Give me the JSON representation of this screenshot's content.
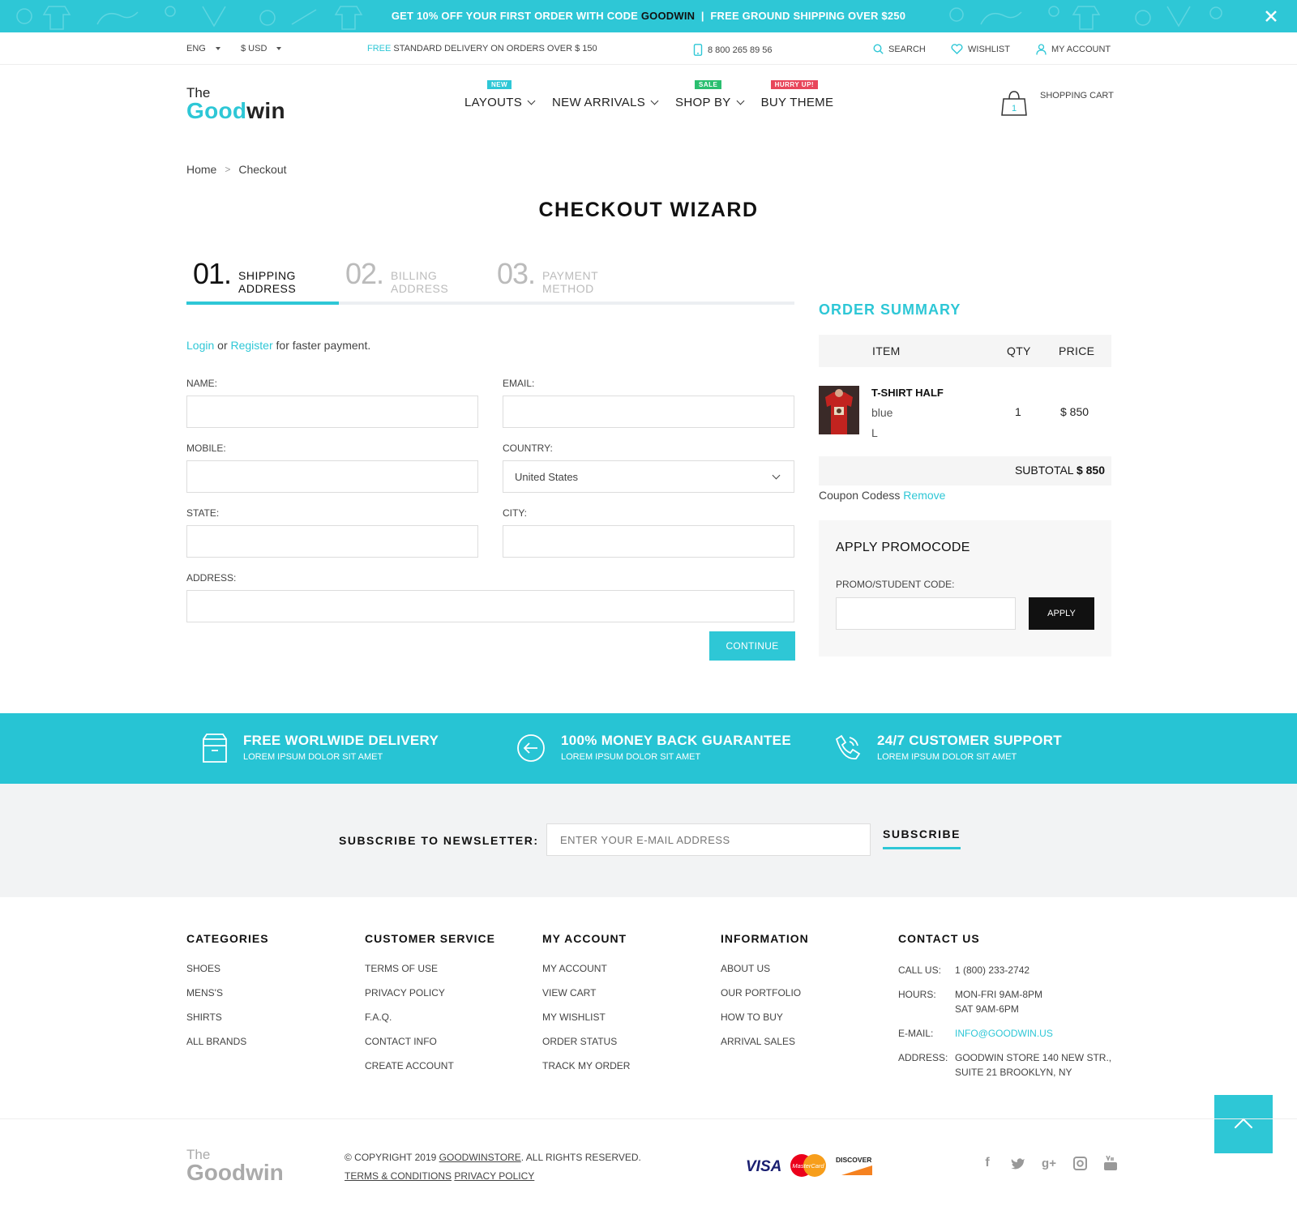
{
  "promo": {
    "prefix": "GET 10% OFF YOUR FIRST ORDER WITH CODE",
    "code": "GOODWIN",
    "separator": "|",
    "suffix": "FREE GROUND SHIPPING OVER $250"
  },
  "topbar": {
    "language": "ENG",
    "currency": "$ USD",
    "delivery_free": "FREE",
    "delivery_text": "STANDARD DELIVERY ON ORDERS OVER $ 150",
    "phone": "8 800 265 89 56",
    "search": "SEARCH",
    "wishlist": "WISHLIST",
    "account": "MY ACCOUNT"
  },
  "logo": {
    "the": "The",
    "good": "Good",
    "win": "win"
  },
  "nav": [
    {
      "label": "LAYOUTS",
      "badge": "NEW"
    },
    {
      "label": "NEW ARRIVALS",
      "badge": ""
    },
    {
      "label": "SHOP BY",
      "badge": "SALE"
    },
    {
      "label": "BUY THEME",
      "badge": "HURRY UP!"
    }
  ],
  "cart": {
    "label": "SHOPPING CART",
    "count": "1"
  },
  "breadcrumb": {
    "home": "Home",
    "sep": ">",
    "current": "Checkout"
  },
  "title": "CHECKOUT WIZARD",
  "steps": [
    {
      "num": "01.",
      "line1": "SHIPPING",
      "line2": "ADDRESS"
    },
    {
      "num": "02.",
      "line1": "BILLING",
      "line2": "ADDRESS"
    },
    {
      "num": "03.",
      "line1": "PAYMENT",
      "line2": "METHOD"
    }
  ],
  "login_line": {
    "login": "Login",
    "or": "or",
    "register": "Register",
    "rest": "for faster payment."
  },
  "form": {
    "name_label": "NAME:",
    "email_label": "EMAIL:",
    "mobile_label": "MOBILE:",
    "country_label": "COUNTRY:",
    "country_value": "United States",
    "state_label": "STATE:",
    "city_label": "CITY:",
    "address_label": "ADDRESS:",
    "continue": "CONTINUE"
  },
  "summary": {
    "title": "ORDER SUMMARY",
    "col_item": "ITEM",
    "col_qty": "QTY",
    "col_price": "PRICE",
    "item_name": "T-SHIRT HALF",
    "item_color": "blue",
    "item_size": "L",
    "item_qty": "1",
    "item_price": "$ 850",
    "subtotal_label": "SUBTOTAL",
    "subtotal_value": "$ 850",
    "coupon_text": "Coupon Codess",
    "coupon_remove": "Remove",
    "promo_title": "APPLY PROMOCODE",
    "promo_label": "PROMO/STUDENT CODE:",
    "promo_apply": "APPLY"
  },
  "features": [
    {
      "title": "FREE WORLWIDE DELIVERY",
      "sub": "LOREM IPSUM DOLOR SIT AMET"
    },
    {
      "title": "100% MONEY BACK GUARANTEE",
      "sub": "LOREM IPSUM DOLOR SIT AMET"
    },
    {
      "title": "24/7 CUSTOMER SUPPORT",
      "sub": "LOREM IPSUM DOLOR SIT AMET"
    }
  ],
  "newsletter": {
    "label": "SUBSCRIBE TO NEWSLETTER:",
    "placeholder": "ENTER YOUR E-MAIL ADDRESS",
    "button": "SUBSCRIBE"
  },
  "footer": {
    "categories": {
      "title": "CATEGORIES",
      "items": [
        "SHOES",
        "MENS'S",
        "SHIRTS",
        "ALL BRANDS"
      ]
    },
    "service": {
      "title": "CUSTOMER SERVICE",
      "items": [
        "TERMS OF USE",
        "PRIVACY POLICY",
        "F.A.Q.",
        "CONTACT INFO",
        "CREATE ACCOUNT"
      ]
    },
    "account": {
      "title": "MY ACCOUNT",
      "items": [
        "MY ACCOUNT",
        "VIEW CART",
        "MY WISHLIST",
        "ORDER STATUS",
        "TRACK MY ORDER"
      ]
    },
    "information": {
      "title": "INFORMATION",
      "items": [
        "ABOUT US",
        "OUR PORTFOLIO",
        "HOW TO BUY",
        "ARRIVAL SALES"
      ]
    },
    "contact": {
      "title": "CONTACT US",
      "call_k": "CALL US:",
      "call_v": "1 (800) 233-2742",
      "hours_k": "HOURS:",
      "hours_v1": "MON-FRI 9AM-8PM",
      "hours_v2": "SAT 9AM-6PM",
      "email_k": "E-MAIL:",
      "email_v": "INFO@GOODWIN.US",
      "addr_k": "ADDRESS:",
      "addr_v1": "GOODWIN STORE 140 NEW STR.,",
      "addr_v2": "SUITE 21 BROOKLYN, NY"
    }
  },
  "bottom": {
    "logo_the": "The",
    "logo_goodwin": "Goodwin",
    "copyright_pre": "© COPYRIGHT 2019",
    "copyright_link": "GOODWINSTORE",
    "copyright_post": ". ALL RIGHTS RESERVED.",
    "terms": "TERMS & CONDITIONS",
    "privacy": "PRIVACY POLICY",
    "cards": [
      "VISA",
      "MasterCard",
      "DISCOVER"
    ],
    "socials": [
      "facebook",
      "twitter",
      "google-plus",
      "instagram",
      "youtube"
    ]
  },
  "colors": {
    "accent": "#2ec7d6",
    "sale_badge": "#2bbf70",
    "hurry_badge": "#e8465b",
    "features_band": "#27c4d4"
  }
}
